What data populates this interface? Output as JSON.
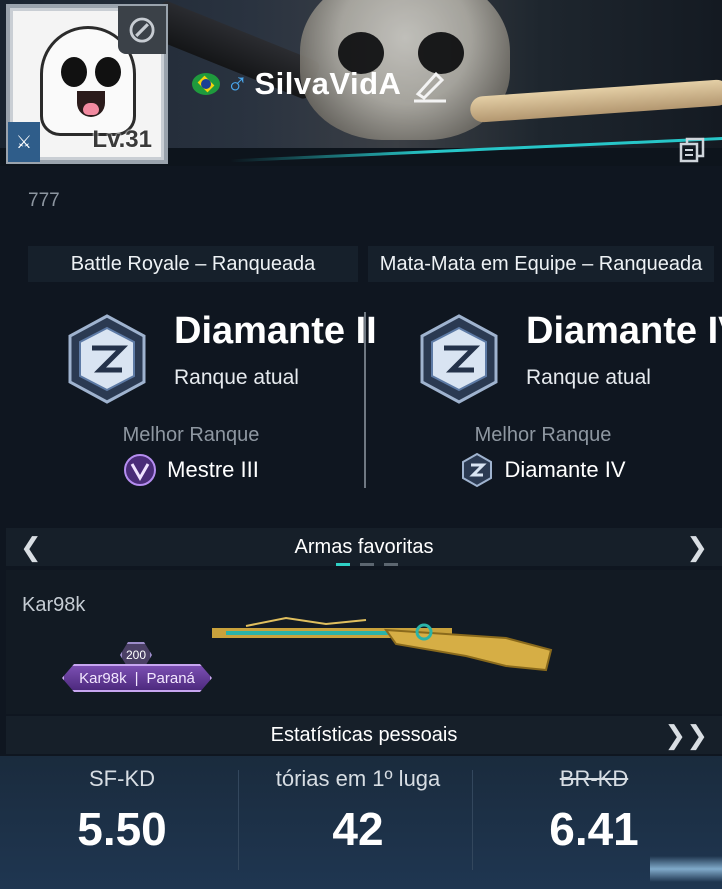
{
  "profile": {
    "level": "Lv.31",
    "player_name": "SilvaVidA",
    "gender_symbol": "♂",
    "country_flag_icon": "brazil-flag-icon",
    "bio": "777"
  },
  "ranked": {
    "battle_royale": {
      "mode_label": "Battle Royale – Ranqueada",
      "rank": "Diamante II",
      "current_label": "Ranque atual",
      "best_label": "Melhor Ranque",
      "best_rank": "Mestre III"
    },
    "team_deathmatch": {
      "mode_label": "Mata-Mata em Equipe – Ranqueada",
      "rank": "Diamante IV",
      "current_label": "Ranque atual",
      "best_label": "Melhor Ranque",
      "best_rank": "Diamante IV"
    }
  },
  "favorite_weapons": {
    "title": "Armas favoritas",
    "prev_arrow": "❮",
    "next_arrow": "❯",
    "weapon_name": "Kar98k",
    "weapon_level": "200",
    "tag_weapon": "Kar98k",
    "tag_separator": "|",
    "tag_skin": "Paraná",
    "page_index": 1,
    "page_count": 3
  },
  "personal_stats": {
    "title": "Estatísticas pessoais",
    "more_arrow": "❯❯",
    "items": [
      {
        "label": "SF-KD",
        "value": "5.50"
      },
      {
        "label": "tórias em 1º luga",
        "value": "42"
      },
      {
        "label": "BR-KD",
        "value": "6.41"
      }
    ]
  },
  "colors": {
    "accent_teal": "#2fd0c5",
    "background": "#0f1620",
    "tag_purple": "#7b4fb2"
  }
}
